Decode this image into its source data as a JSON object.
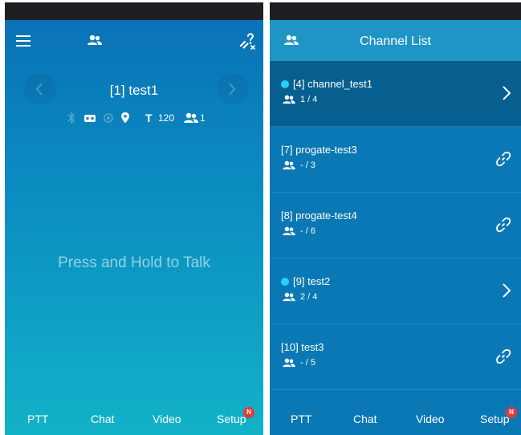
{
  "left": {
    "channel_title": "[1] test1",
    "status": {
      "tx_label": "T",
      "tx_value": "120",
      "user_count": "1"
    },
    "ptt_prompt": "Press and Hold to Talk"
  },
  "right": {
    "title": "Channel List",
    "channels": [
      {
        "name": "[4] channel_test1",
        "members": "1 / 4",
        "active": true,
        "online": true,
        "action": "chevron-right"
      },
      {
        "name": "[7] progate-test3",
        "members": "- / 3",
        "active": false,
        "online": false,
        "action": "link"
      },
      {
        "name": "[8] progate-test4",
        "members": "- / 6",
        "active": false,
        "online": false,
        "action": "link"
      },
      {
        "name": "[9] test2",
        "members": "2 / 4",
        "active": false,
        "online": true,
        "action": "chevron-right"
      },
      {
        "name": "[10] test3",
        "members": "- / 5",
        "active": false,
        "online": false,
        "action": "link"
      }
    ]
  },
  "tabs": [
    "PTT",
    "Chat",
    "Video",
    "Setup"
  ],
  "badge": "N",
  "colors": {
    "accent_dot": "#27d2f5",
    "badge": "#e5383b",
    "active_row": "#075f90",
    "header": "#1f95c6"
  }
}
